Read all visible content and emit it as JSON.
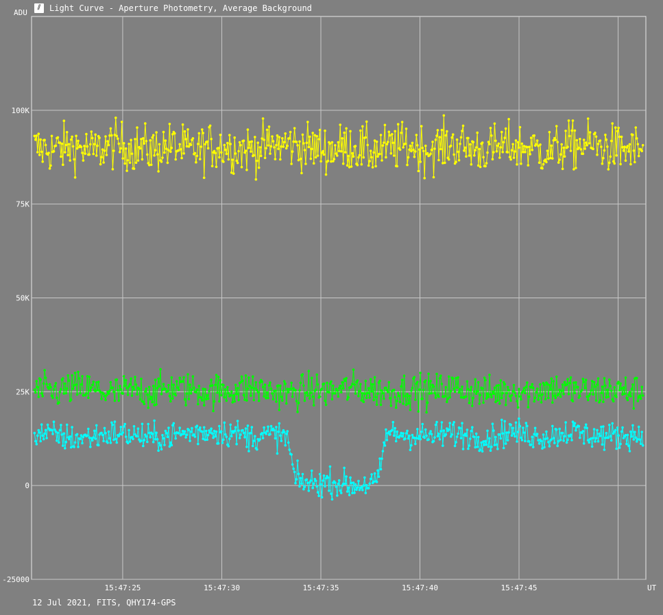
{
  "window": {
    "title": "Light Curve - Aperture Photometry, Average Background",
    "icon": "light-curve-icon"
  },
  "footer_text": "12 Jul 2021, FITS, QHY174-GPS",
  "colors": {
    "background": "#808080",
    "grid": "#c8c8c8",
    "axis": "#e8e8e8",
    "series_target": "#00ffff",
    "series_comparison": "#00ff00",
    "series_background": "#ffff00"
  },
  "chart_data": {
    "type": "line",
    "title": "Light Curve - Aperture Photometry, Average Background",
    "ylabel": "ADU",
    "xlabel": "UT",
    "ylim": [
      -25000,
      125000
    ],
    "xlim_seconds_of_15_47": [
      20.4,
      51.4
    ],
    "y_ticks": [
      {
        "value": -25000,
        "label": "-25000"
      },
      {
        "value": 0,
        "label": "0"
      },
      {
        "value": 25000,
        "label": "25K"
      },
      {
        "value": 50000,
        "label": "50K"
      },
      {
        "value": 75000,
        "label": "75K"
      },
      {
        "value": 100000,
        "label": "100K"
      }
    ],
    "x_ticks": [
      {
        "value": 25,
        "label": "15:47:25"
      },
      {
        "value": 30,
        "label": "15:47:30"
      },
      {
        "value": 35,
        "label": "15:47:35"
      },
      {
        "value": 40,
        "label": "15:47:40"
      },
      {
        "value": 45,
        "label": "15:47:45"
      },
      {
        "value": 50,
        "label": ""
      }
    ],
    "grid": true,
    "series": [
      {
        "name": "",
        "color": "#ffff00",
        "x": [
          20.5,
          21.5,
          22.5,
          23.5,
          24.5,
          25.5,
          26.5,
          27.5,
          28.5,
          29.5,
          30.5,
          31.5,
          32.5,
          33.5,
          34.5,
          35.5,
          36.5,
          37.5,
          38.5,
          39.5,
          40.5,
          41.5,
          42.5,
          43.5,
          44.5,
          45.5,
          46.5,
          47.5,
          48.5,
          49.5,
          50.5
        ],
        "y": [
          90000,
          89500,
          90500,
          89000,
          91000,
          90000,
          89500,
          90500,
          89000,
          90500,
          90000,
          89500,
          90500,
          91000,
          90000,
          89500,
          90500,
          89000,
          90000,
          90500,
          89500,
          91000,
          90000,
          89500,
          90500,
          90000,
          89000,
          90500,
          91000,
          90000,
          89500
        ],
        "spread": 4500
      },
      {
        "name": "",
        "color": "#00ff00",
        "x": [
          20.5,
          21.5,
          22.5,
          23.5,
          24.5,
          25.5,
          26.5,
          27.5,
          28.5,
          29.5,
          30.5,
          31.5,
          32.5,
          33.5,
          34.5,
          35.5,
          36.5,
          37.5,
          38.5,
          39.5,
          40.5,
          41.5,
          42.5,
          43.5,
          44.5,
          45.5,
          46.5,
          47.5,
          48.5,
          49.5,
          50.5
        ],
        "y": [
          25500,
          25000,
          26000,
          25500,
          24500,
          25500,
          25000,
          26000,
          25500,
          25000,
          25500,
          26000,
          25000,
          24500,
          25500,
          25000,
          26000,
          25500,
          25000,
          25500,
          25000,
          26000,
          25500,
          24500,
          25500,
          25000,
          26000,
          25500,
          25000,
          25500,
          25000
        ],
        "spread": 3200
      },
      {
        "name": "",
        "color": "#00ffff",
        "x": [
          20.5,
          21.5,
          22.5,
          23.5,
          24.5,
          25.5,
          26.5,
          27.5,
          28.5,
          29.5,
          30.5,
          31.5,
          32.5,
          33.3,
          33.7,
          34.5,
          35.5,
          36.5,
          37.5,
          37.9,
          38.3,
          39.5,
          40.5,
          41.5,
          42.5,
          43.5,
          44.5,
          45.5,
          46.5,
          47.5,
          48.5,
          49.5,
          50.5
        ],
        "y": [
          14000,
          13500,
          12500,
          13000,
          14000,
          13500,
          12500,
          13500,
          14000,
          14500,
          14000,
          13000,
          13500,
          13000,
          1500,
          500,
          1000,
          0,
          500,
          1000,
          14000,
          13500,
          13000,
          14000,
          13500,
          12500,
          14500,
          13500,
          13000,
          14500,
          13500,
          13000,
          13500
        ],
        "spread": 2600
      }
    ]
  }
}
